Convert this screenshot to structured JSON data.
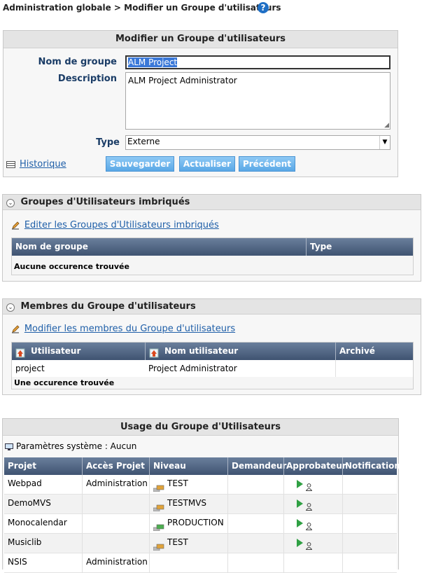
{
  "breadcrumb": "Administration globale > Modifier un Groupe d'utilisateurs",
  "edit": {
    "title": "Modifier un Groupe d'utilisateurs",
    "name_label": "Nom de groupe",
    "name_value": "ALM Project",
    "desc_label": "Description",
    "desc_value": "ALM Project Administrator",
    "type_label": "Type",
    "type_value": "Externe",
    "history_label": "Historique",
    "save_label": "Sauvegarder",
    "refresh_label": "Actualiser",
    "prev_label": "Précédent"
  },
  "nested": {
    "title": "Groupes d'Utilisateurs imbriqués",
    "edit_link": "Editer les Groupes d'Utilisateurs imbriqués",
    "columns": [
      "Nom de groupe",
      "Type"
    ],
    "empty": "Aucune occurence trouvée"
  },
  "members": {
    "title": "Membres du Groupe d'utilisateurs",
    "edit_link": "Modifier les membres du Groupe d'utilisateurs",
    "columns": [
      "Utilisateur",
      "Nom utilisateur",
      "Archivé"
    ],
    "rows": [
      [
        "project",
        "Project Administrator",
        ""
      ]
    ],
    "count": "Une occurence trouvée"
  },
  "usage": {
    "title": "Usage du Groupe d'Utilisateurs",
    "system_params": "Paramètres système : Aucun",
    "columns": [
      "Projet",
      "Accès Projet",
      "Niveau",
      "Demandeur",
      "Approbateur",
      "Notification"
    ],
    "rows": [
      {
        "projet": "Webpad",
        "acces": "Administration",
        "niveau": "TEST",
        "approver": true
      },
      {
        "projet": "DemoMVS",
        "acces": "",
        "niveau": "TESTMVS",
        "approver": true
      },
      {
        "projet": "Monocalendar",
        "acces": "",
        "niveau": "PRODUCTION",
        "approver": true
      },
      {
        "projet": "Musiclib",
        "acces": "",
        "niveau": "TEST",
        "approver": true
      },
      {
        "projet": "NSIS",
        "acces": "Administration",
        "niveau": "",
        "approver": false
      }
    ]
  }
}
